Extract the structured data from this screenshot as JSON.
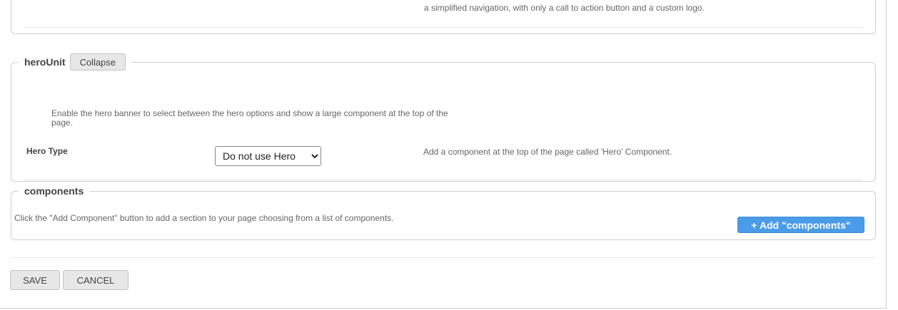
{
  "top_panel": {
    "text": "a simplified navigation, with only a call to action button and a custom logo."
  },
  "hero_unit": {
    "legend": "heroUnit",
    "collapse_label": "Collapse",
    "description": "Enable the hero banner to select between the hero options and show a large component at the top of the page.",
    "field_label": "Hero Type",
    "select_value": "Do not use Hero",
    "help_text": "Add a component at the top of the page called 'Hero' Component."
  },
  "components": {
    "legend": "components",
    "description": "Click the \"Add Component\" button to add a section to your page choosing from a list of components.",
    "add_button_label": "+ Add \"components\""
  },
  "footer": {
    "save_label": "SAVE",
    "cancel_label": "CANCEL"
  },
  "colors": {
    "accent": "#4a9be8",
    "button_bg": "#e7e7e7"
  }
}
